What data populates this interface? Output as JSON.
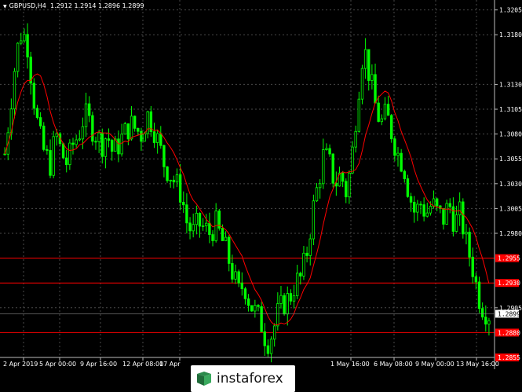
{
  "header": {
    "symbol": "GBPUSD,H4",
    "ohlc": "1.2912 1.2914 1.2896 1.2899"
  },
  "watermark": {
    "text": "instaforex",
    "icon": "instaforex-logo-icon"
  },
  "colors": {
    "background": "#000000",
    "grid": "#4a4a4a",
    "candle": "#00ff00",
    "ma": "#ff0000",
    "level": "#ff0000",
    "current_price": "#ffffff",
    "axis_text": "#ffffff"
  },
  "chart_data": {
    "type": "candlestick",
    "grid": true,
    "ylim": [
      1.2855,
      1.3215
    ],
    "y_ticks": [
      "1.3205",
      "1.3180",
      "1.3130",
      "1.3105",
      "1.3080",
      "1.3055",
      "1.3030",
      "1.3005",
      "1.2980",
      "1.2905"
    ],
    "x_ticks": [
      "2 Apr 2019",
      "5 Apr 00:00",
      "9 Apr 16:00",
      "12 Apr 08:00",
      "17 Apr",
      "1 May 16:00",
      "6 May 08:00",
      "9 May 00:00",
      "13 May 16:00"
    ],
    "current_price": {
      "value": 1.2899,
      "label": "1.2899"
    },
    "levels": [
      {
        "value": 1.2955,
        "label": "1.2955"
      },
      {
        "value": 1.293,
        "label": "1.2930"
      },
      {
        "value": 1.288,
        "label": "1.2880"
      },
      {
        "value": 1.2855,
        "label": "1.2855"
      }
    ],
    "close_path": [
      1.306,
      1.311,
      1.316,
      1.3185,
      1.317,
      1.312,
      1.308,
      1.306,
      1.305,
      1.308,
      1.306,
      1.305,
      1.307,
      1.308,
      1.31,
      1.309,
      1.308,
      1.307,
      1.308,
      1.306,
      1.307,
      1.308,
      1.309,
      1.3085,
      1.308,
      1.31,
      1.309,
      1.307,
      1.305,
      1.304,
      1.303,
      1.302,
      1.299,
      1.298,
      1.299,
      1.2985,
      1.298,
      1.299,
      1.2975,
      1.296,
      1.294,
      1.292,
      1.293,
      1.291,
      1.29,
      1.289,
      1.287,
      1.288,
      1.29,
      1.291,
      1.2915,
      1.293,
      1.2935,
      1.296,
      1.3,
      1.303,
      1.306,
      1.305,
      1.303,
      1.304,
      1.302,
      1.306,
      1.312,
      1.317,
      1.314,
      1.311,
      1.309,
      1.31,
      1.308,
      1.306,
      1.305,
      1.302,
      1.3,
      1.301,
      1.3,
      1.301,
      1.3,
      1.2995,
      1.301,
      1.299,
      1.3,
      1.297,
      1.295,
      1.292,
      1.2905,
      1.2899
    ]
  }
}
